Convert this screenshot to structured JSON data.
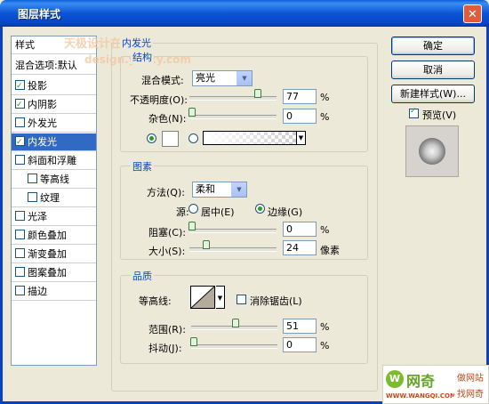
{
  "window": {
    "title": "图层样式",
    "close_glyph": "✕"
  },
  "style_list": {
    "header": "样式",
    "blend_options": "混合选项:默认",
    "items": [
      {
        "label": "投影",
        "checked": true
      },
      {
        "label": "内阴影",
        "checked": true
      },
      {
        "label": "外发光",
        "checked": false
      },
      {
        "label": "内发光",
        "checked": true,
        "selected": true
      },
      {
        "label": "斜面和浮雕",
        "checked": false
      },
      {
        "label": "等高线",
        "checked": false
      },
      {
        "label": "纹理",
        "checked": false
      },
      {
        "label": "光泽",
        "checked": false
      },
      {
        "label": "颜色叠加",
        "checked": false
      },
      {
        "label": "渐变叠加",
        "checked": false
      },
      {
        "label": "图案叠加",
        "checked": false
      },
      {
        "label": "描边",
        "checked": false
      }
    ]
  },
  "panel": {
    "section_title": "内发光",
    "structure": {
      "title": "结构",
      "blend_mode_label": "混合模式:",
      "blend_mode_value": "亮光",
      "opacity_label": "不透明度(O):",
      "opacity_value": "77",
      "noise_label": "杂色(N):",
      "noise_value": "0",
      "percent": "%"
    },
    "elements": {
      "title": "图素",
      "method_label": "方法(Q):",
      "method_value": "柔和",
      "source_label": "源:",
      "center_label": "居中(E)",
      "edge_label": "边缘(G)",
      "choke_label": "阻塞(C):",
      "choke_value": "0",
      "size_label": "大小(S):",
      "size_value": "24",
      "px_unit": "像素",
      "percent": "%"
    },
    "quality": {
      "title": "品质",
      "contour_label": "等高线:",
      "anti_alias_label": "消除锯齿(L)",
      "range_label": "范围(R):",
      "range_value": "51",
      "jitter_label": "抖动(J):",
      "jitter_value": "0",
      "percent": "%"
    }
  },
  "buttons": {
    "ok": "确定",
    "cancel": "取消",
    "new_style": "新建样式(W)...",
    "preview": "预览(V)"
  },
  "watermark": {
    "line1": "天极设计在线",
    "line2": "design.yesky.com",
    "site_name": "网奇",
    "site_url": "WWW.WANGQI.COM",
    "side1": "做网站",
    "side2": "找网奇"
  }
}
